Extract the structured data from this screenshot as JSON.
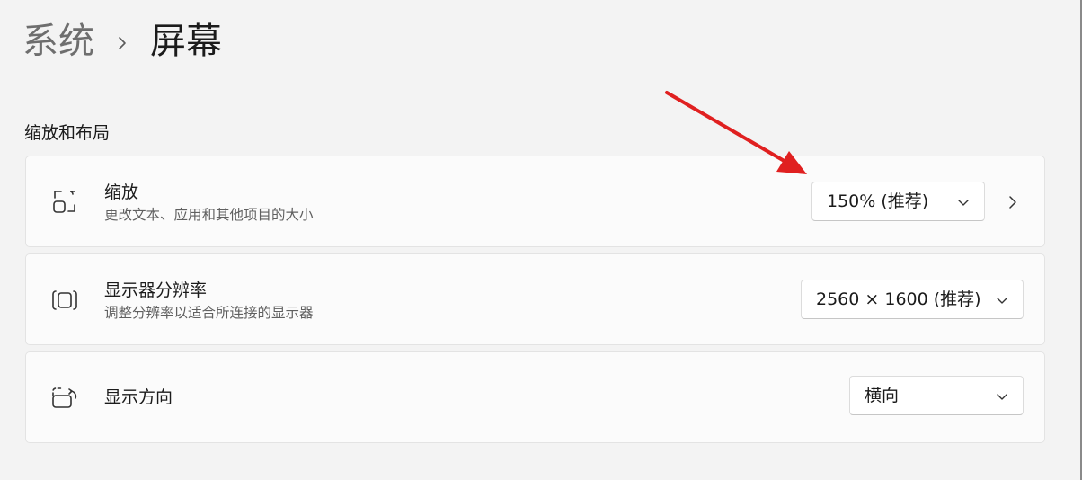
{
  "breadcrumb": {
    "parent": "系统",
    "current": "屏幕"
  },
  "section": {
    "title": "缩放和布局"
  },
  "settings": [
    {
      "icon": "scale-icon",
      "title": "缩放",
      "description": "更改文本、应用和其他项目的大小",
      "value": "150% (推荐)",
      "has_expand": true
    },
    {
      "icon": "resolution-icon",
      "title": "显示器分辨率",
      "description": "调整分辨率以适合所连接的显示器",
      "value": "2560 × 1600 (推荐)",
      "has_expand": false
    },
    {
      "icon": "orientation-icon",
      "title": "显示方向",
      "description": "",
      "value": "横向",
      "has_expand": false
    }
  ],
  "annotation": {
    "icon": "red-arrow-icon",
    "color": "#e02020"
  },
  "colors": {
    "background": "#f3f3f3",
    "card": "#fbfbfb"
  }
}
